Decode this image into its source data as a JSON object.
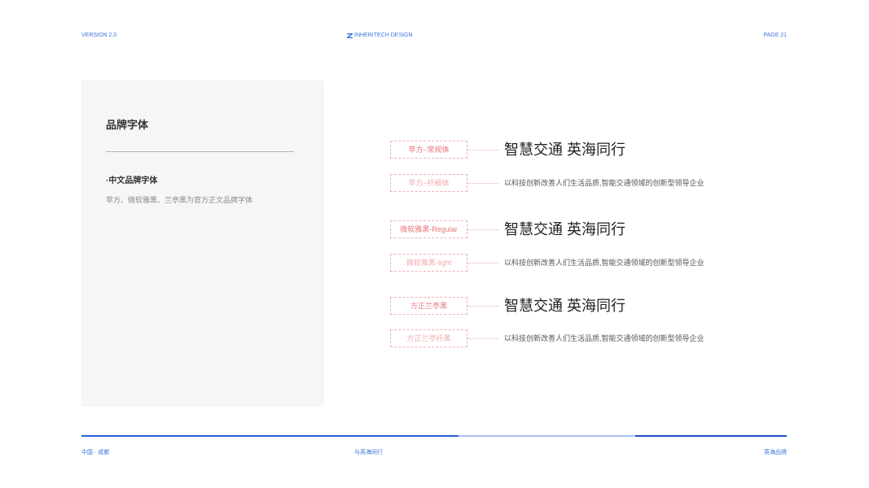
{
  "header": {
    "version": "VERSION 2.0",
    "brand": "INHERITECH DESIGN",
    "page": "PAGE 21",
    "logo_icon": "brand-logo-icon"
  },
  "panel": {
    "title": "品牌字体",
    "subtitle": "·中文品牌字体",
    "description": "苹方、微软雅黑、兰亭黑为官方正文品牌字体"
  },
  "specimens": [
    {
      "label": "苹方–常规体",
      "sample": "智慧交通 英海同行"
    },
    {
      "label": "苹方–纤细体",
      "sample": "以科技创新改善人们生活品质,智能交通领域的创新型领导企业"
    },
    {
      "label": "微软雅黑-Regular",
      "sample": "智慧交通 英海同行"
    },
    {
      "label": "微软雅黑-light",
      "sample": "以科技创新改善人们生活品质,智能交通领域的创新型领导企业"
    },
    {
      "label": "方正兰亭黑",
      "sample": "智慧交通 英海同行"
    },
    {
      "label": "方正兰亭纤黑",
      "sample": "以科技创新改善人们生活品质,智能交通领域的创新型领导企业"
    }
  ],
  "footer": {
    "location": "中国 · 成都",
    "slogan": "与英海同行",
    "brand": "英海品牌"
  },
  "colors": {
    "accent": "#3d74dc",
    "panel_bg": "#f5f6f8",
    "label": "#e8757b",
    "label_light": "#f2abaf",
    "rule_primary": "#2b5fd8",
    "rule_light": "#a9c0f2",
    "rule_dark": "#1f4cc2"
  }
}
